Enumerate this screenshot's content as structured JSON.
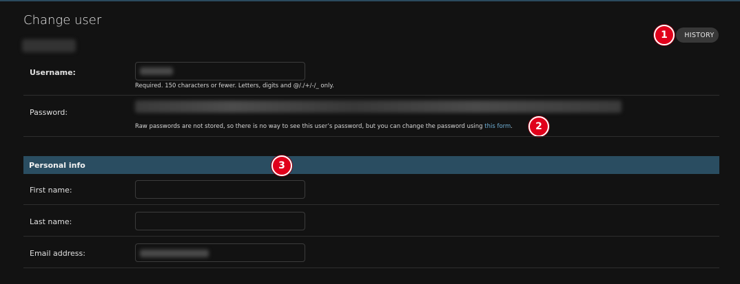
{
  "page": {
    "title": "Change user"
  },
  "object_tools": {
    "history_label": "HISTORY"
  },
  "username": {
    "label": "Username:",
    "help": "Required. 150 characters or fewer. Letters, digits and @/./+/-/_ only."
  },
  "password": {
    "label": "Password:",
    "help_prefix": "Raw passwords are not stored, so there is no way to see this user’s password, but you can change the password using ",
    "link_text": "this form",
    "help_suffix": "."
  },
  "personal_info": {
    "header": "Personal info",
    "first_name_label": "First name:",
    "last_name_label": "Last name:",
    "email_label": "Email address:"
  },
  "markers": [
    "1",
    "2",
    "3"
  ],
  "colors": {
    "background": "#121212",
    "fieldset_header": "#2a4d61",
    "link": "#6fb0d6",
    "marker": "#e0001b"
  }
}
